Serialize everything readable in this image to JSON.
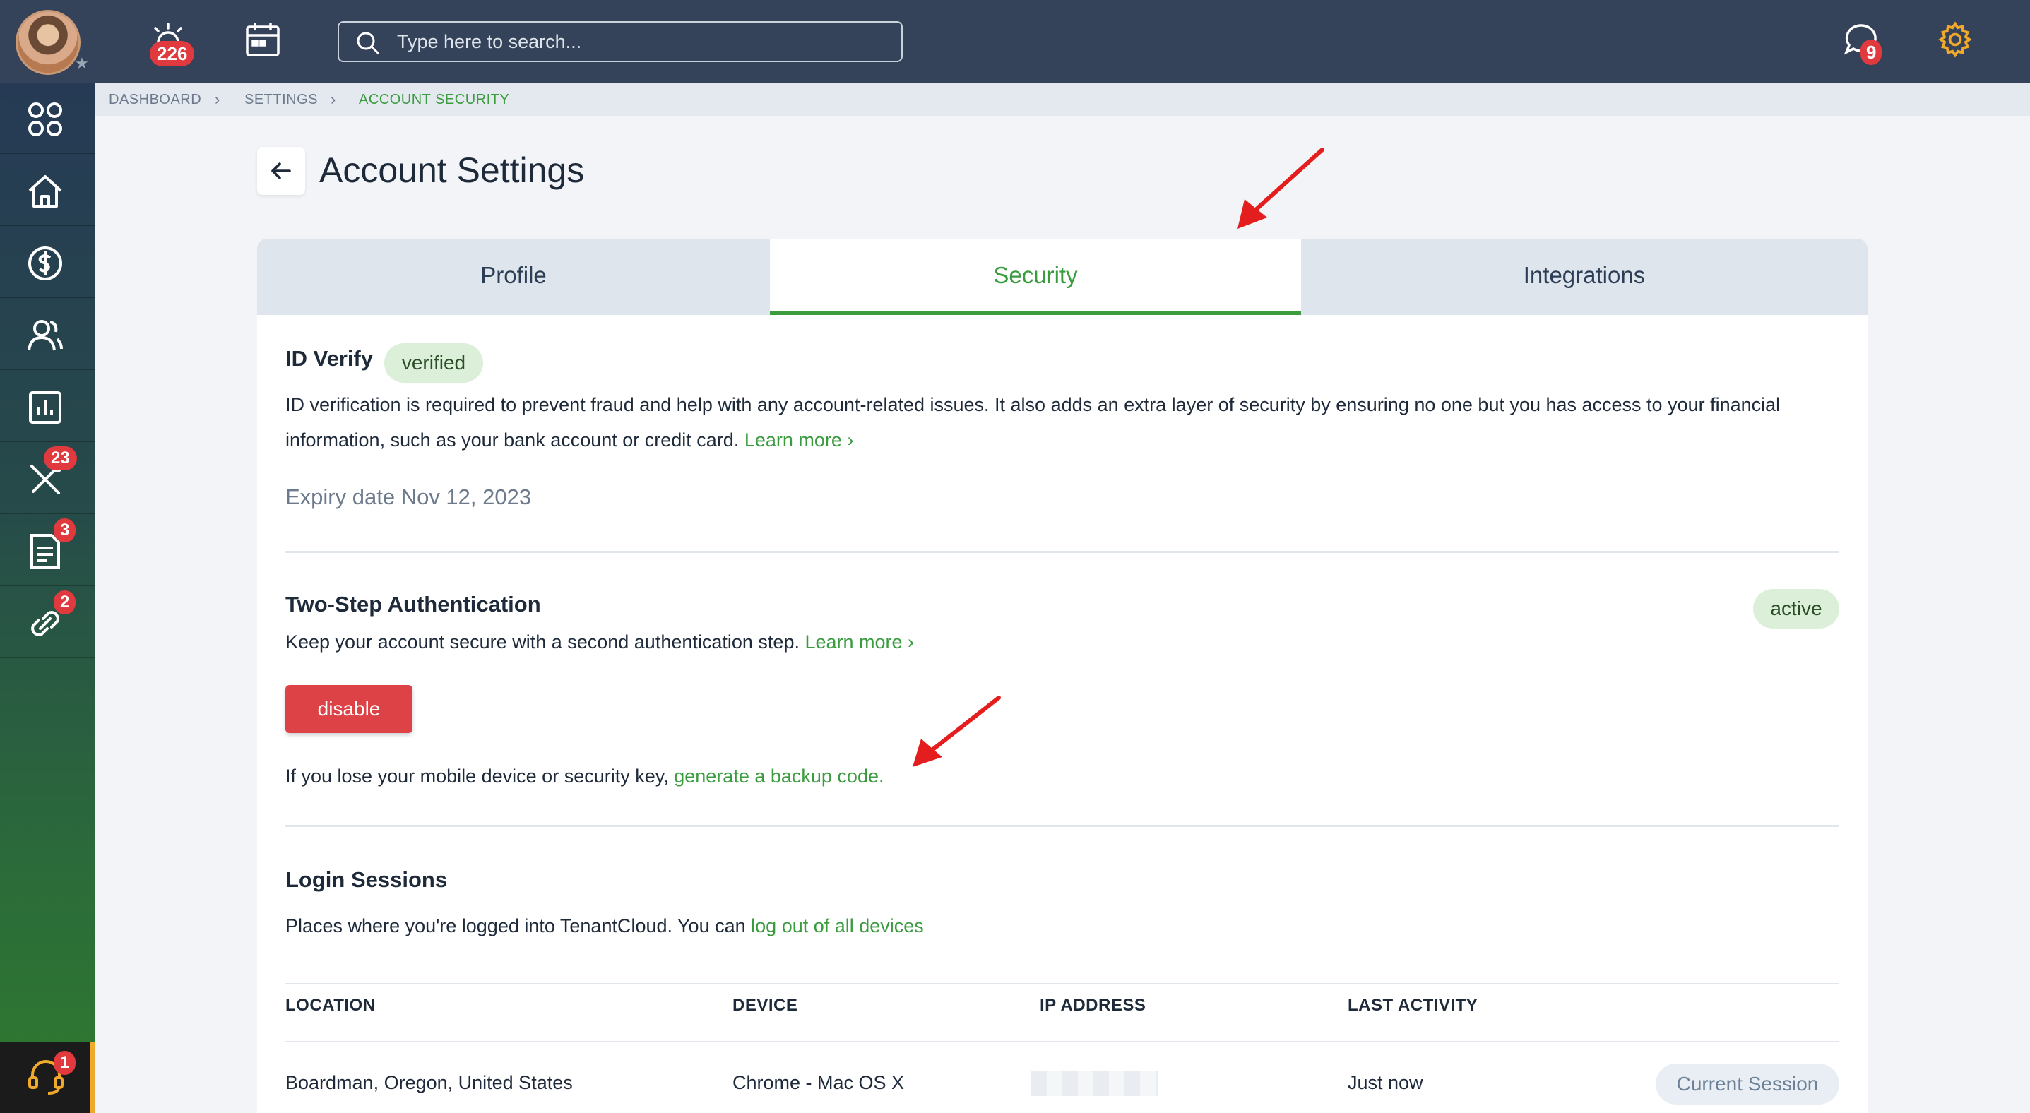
{
  "topbar": {
    "notifications_count": "226",
    "search_placeholder": "Type here to search...",
    "messages_count": "9"
  },
  "sidebar": {
    "badges": {
      "tools": "23",
      "documents": "3",
      "links": "2",
      "help": "1"
    }
  },
  "breadcrumb": [
    "DASHBOARD",
    "SETTINGS",
    "ACCOUNT SECURITY"
  ],
  "page": {
    "title": "Account Settings"
  },
  "tabs": [
    "Profile",
    "Security",
    "Integrations"
  ],
  "id_verify": {
    "title": "ID Verify",
    "status": "verified",
    "desc_line1": "ID verification is required to prevent fraud and help with any account-related issues. It also adds an extra layer of security by ensuring no one but you has access to your financial",
    "desc_line2": "information, such as your bank account or credit card.",
    "learn_more": "Learn more",
    "expiry": "Expiry date Nov 12, 2023"
  },
  "two_step": {
    "title": "Two-Step Authentication",
    "status": "active",
    "desc": "Keep your account secure with a second authentication step.",
    "learn_more": "Learn more",
    "disable_label": "disable",
    "backup_text": "If you lose your mobile device or security key,",
    "backup_link": "generate a backup code."
  },
  "sessions": {
    "title": "Login Sessions",
    "desc": "Places where you're logged into TenantCloud. You can",
    "logout_link": "log out of all devices",
    "columns": [
      "LOCATION",
      "DEVICE",
      "IP ADDRESS",
      "LAST ACTIVITY"
    ],
    "rows": [
      {
        "location": "Boardman, Oregon, United States",
        "device": "Chrome - Mac OS X",
        "last_activity": "Just now",
        "action": "Current Session"
      }
    ]
  },
  "colors": {
    "accent": "#3a9b3f",
    "danger": "#dd4246",
    "topbar": "#34425a"
  }
}
